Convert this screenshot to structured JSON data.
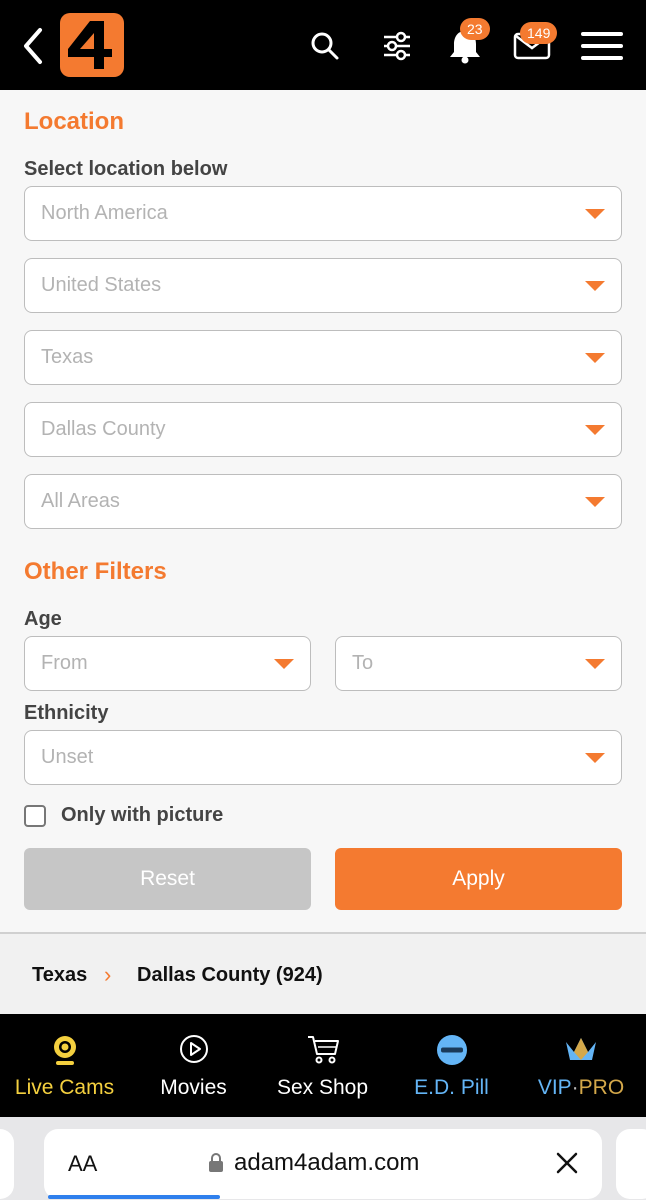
{
  "header": {
    "logo_text": "4",
    "notifications_count": "23",
    "messages_count": "149"
  },
  "location": {
    "title": "Location",
    "subtitle": "Select location below",
    "selects": [
      "North America",
      "United States",
      "Texas",
      "Dallas County",
      "All Areas"
    ]
  },
  "filters": {
    "title": "Other Filters",
    "age_label": "Age",
    "age_from": "From",
    "age_to": "To",
    "ethnicity_label": "Ethnicity",
    "ethnicity_value": "Unset",
    "only_picture_label": "Only with picture",
    "reset_label": "Reset",
    "apply_label": "Apply"
  },
  "breadcrumb": {
    "state": "Texas",
    "separator": "›",
    "county": "Dallas County (924)"
  },
  "bottom_nav": {
    "items": [
      {
        "label": "Live Cams",
        "icon": "webcam-icon"
      },
      {
        "label": "Movies",
        "icon": "play-icon"
      },
      {
        "label": "Sex Shop",
        "icon": "cart-icon"
      },
      {
        "label": "E.D. Pill",
        "icon": "pill-icon"
      },
      {
        "label_vip": "VIP",
        "label_dot": "·",
        "label_pro": "PRO",
        "icon": "crown-icon"
      }
    ]
  },
  "browser": {
    "aa_label": "AA",
    "url": "adam4adam.com"
  },
  "colors": {
    "accent": "#f47a30",
    "header_bg": "#000000",
    "live_cams": "#f4d03f",
    "ed_pill": "#64b5f6",
    "pro_gold": "#d4a84a"
  }
}
